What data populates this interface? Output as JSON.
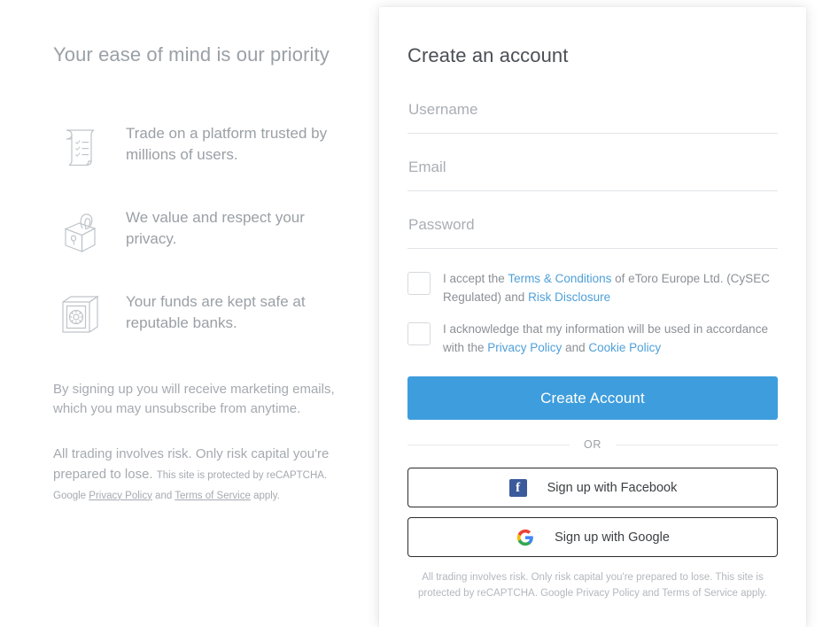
{
  "left": {
    "title": "Your ease of mind is our priority",
    "features": [
      {
        "icon": "scroll-checklist-icon",
        "text": "Trade on a platform trusted by millions of users."
      },
      {
        "icon": "padlock-icon",
        "text": "We value and respect your privacy."
      },
      {
        "icon": "safe-vault-icon",
        "text": "Your funds are kept safe at reputable banks."
      }
    ],
    "marketing_note": "By signing up you will receive marketing emails, which you may unsubscribe from anytime.",
    "risk_main": "All trading involves risk. Only risk capital you're prepared to lose.",
    "recaptcha_prefix": "This site is protected by reCAPTCHA. Google ",
    "recaptcha_privacy": "Privacy Policy",
    "recaptcha_and": " and ",
    "recaptcha_terms": "Terms of Service",
    "recaptcha_suffix": " apply."
  },
  "card": {
    "title": "Create an account",
    "fields": [
      {
        "name": "username",
        "placeholder": "Username",
        "value": ""
      },
      {
        "name": "email",
        "placeholder": "Email",
        "value": ""
      },
      {
        "name": "password",
        "placeholder": "Password",
        "value": ""
      }
    ],
    "terms_checkbox": {
      "part1": "I accept the ",
      "link1": "Terms & Conditions",
      "part2": " of eToro Europe Ltd. (CySEC Regulated) and ",
      "link2": "Risk Disclosure"
    },
    "privacy_checkbox": {
      "part1": "I acknowledge that my information will be used in accordance with the ",
      "link1": "Privacy Policy",
      "part2": " and ",
      "link2": "Cookie Policy"
    },
    "submit_label": "Create Account",
    "or_label": "OR",
    "facebook_label": "Sign up with Facebook",
    "facebook_icon": "facebook-icon",
    "google_label": "Sign up with Google",
    "google_icon": "google-icon",
    "footnote": "All trading involves risk. Only risk capital you're prepared to lose. This site is protected by reCAPTCHA. Google Privacy Policy and Terms of Service apply."
  },
  "colors": {
    "accent": "#3e9ddd",
    "link": "#4fa0d8",
    "muted_text": "#9aa0a6",
    "facebook_blue": "#3b5a9b"
  }
}
